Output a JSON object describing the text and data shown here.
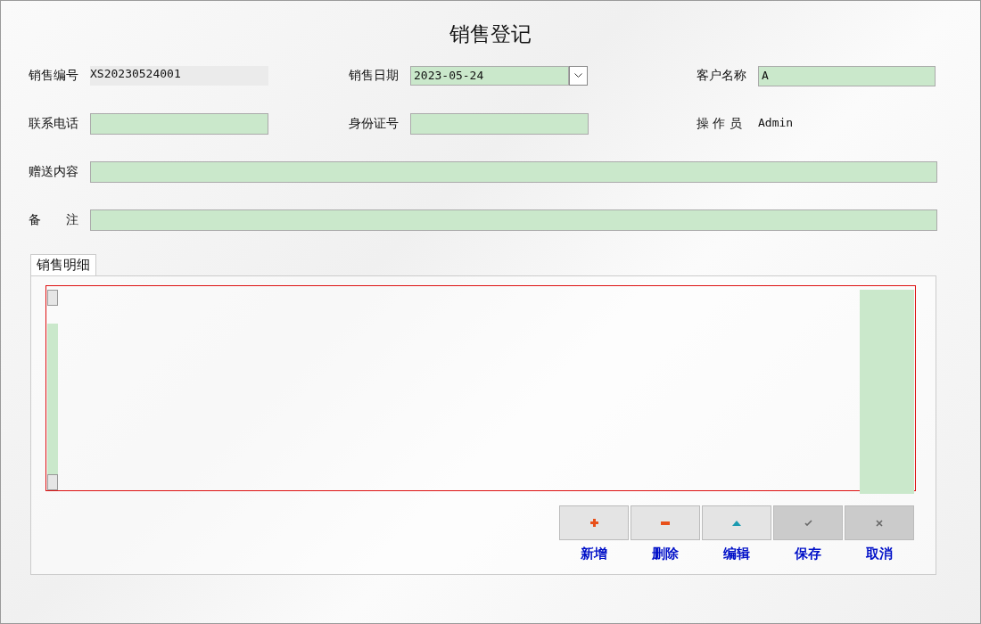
{
  "window": {
    "title": "销售登记"
  },
  "fields": [
    {
      "label": "销售编号",
      "kind": "display",
      "value": "XS20230524001"
    },
    {
      "label": "销售日期",
      "kind": "date",
      "value": "2023-05-24"
    },
    {
      "label": "客户名称",
      "kind": "input",
      "value": "A"
    },
    {
      "label": "联系电话",
      "kind": "input"
    },
    {
      "label": "身份证号",
      "kind": "input"
    },
    {
      "label": "操 作 员",
      "kind": "text",
      "value": "Admin"
    },
    {
      "label": "赠送内容",
      "kind": "wide"
    },
    {
      "label": "备　　注",
      "kind": "wide"
    }
  ],
  "tabs": [
    {
      "label": "销售明细",
      "selected": true
    }
  ],
  "buttons": [
    {
      "label": "新增",
      "kind": "plus",
      "disabled": false
    },
    {
      "label": "删除",
      "kind": "minus",
      "disabled": false
    },
    {
      "label": "编辑",
      "kind": "up",
      "disabled": false
    },
    {
      "label": "保存",
      "kind": "check",
      "disabled": true
    },
    {
      "label": "取消",
      "kind": "cross",
      "disabled": true
    }
  ]
}
